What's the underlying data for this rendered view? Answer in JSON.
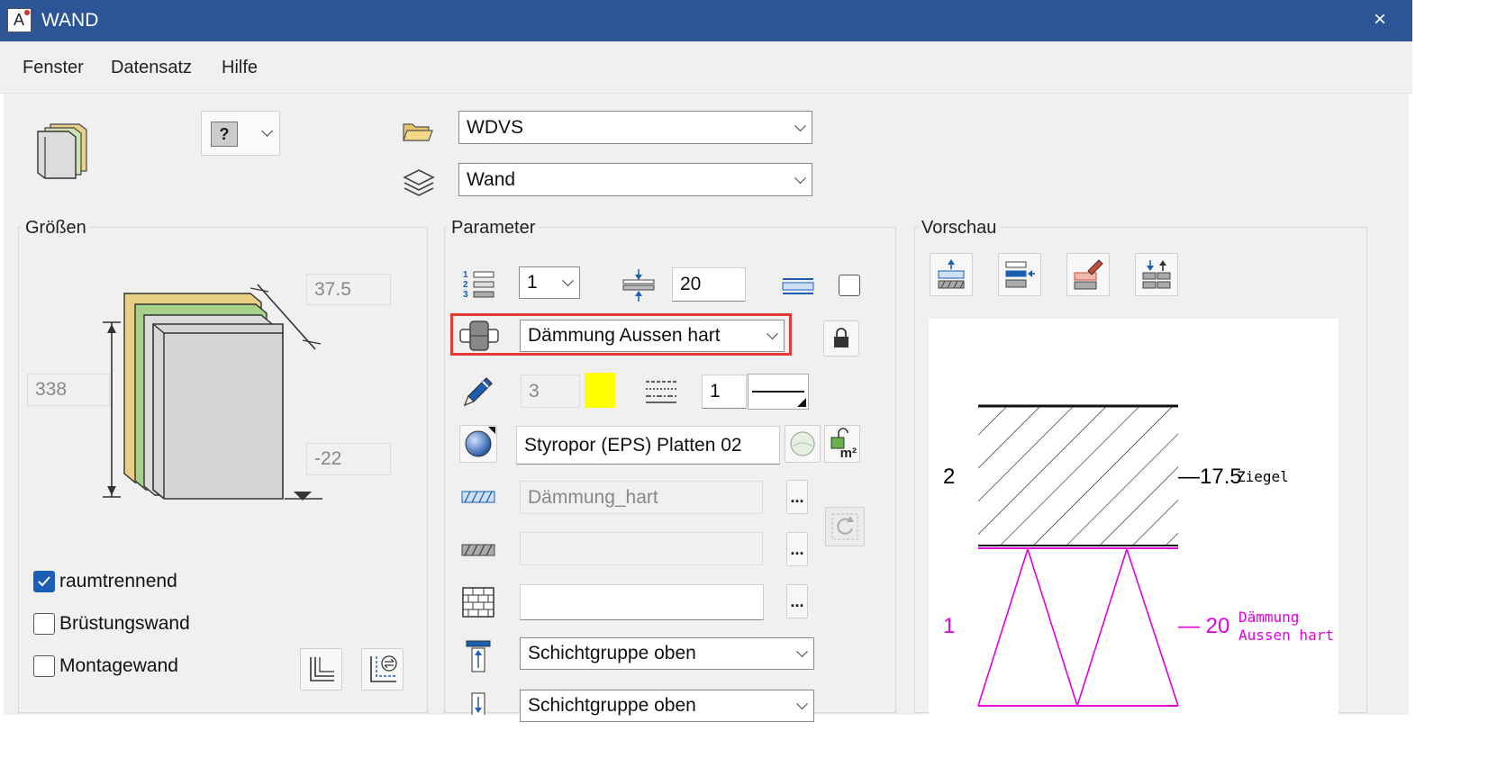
{
  "window": {
    "title": "WAND",
    "close": "×",
    "app_icon": "A"
  },
  "menu": [
    {
      "label": "Fenster"
    },
    {
      "label": "Datensatz"
    },
    {
      "label": "Hilfe"
    }
  ],
  "top": {
    "folder_combo": "WDVS",
    "layer_combo": "Wand",
    "help_glyph": "?"
  },
  "groessen": {
    "title": "Größen",
    "thickness": "37.5",
    "height": "338",
    "offset": "-22",
    "checkboxes": [
      {
        "label": "raumtrennend",
        "checked": true
      },
      {
        "label": "Brüstungswand",
        "checked": false
      },
      {
        "label": "Montagewand",
        "checked": false
      }
    ]
  },
  "parameter": {
    "title": "Parameter",
    "layer_number": "1",
    "layer_thickness": "20",
    "layer_type": "Dämmung Aussen hart",
    "pen": "3",
    "pen_color": "#ffff00",
    "line_type": "1",
    "material": "Styropor (EPS) Platten 02",
    "hatch": "Dämmung_hart",
    "hatch2": "",
    "pattern": "",
    "dots_label": "...",
    "group_top": "Schichtgruppe oben",
    "group_bottom": "Schichtgruppe oben",
    "m2_label": "m²",
    "number_icons": [
      "1",
      "2",
      "3"
    ]
  },
  "vorschau": {
    "title": "Vorschau",
    "layers": [
      {
        "num": "2",
        "thick": "—17.5",
        "name": "Ziegel",
        "color": "#000000"
      },
      {
        "num": "1",
        "thick": "— 20",
        "name_line1": "Dämmung",
        "name_line2": "Aussen hart",
        "color": "#e000e0"
      }
    ]
  },
  "colors": {
    "accent": "#2b5597",
    "highlight": "#e53935",
    "insulation": "#e000e0"
  }
}
